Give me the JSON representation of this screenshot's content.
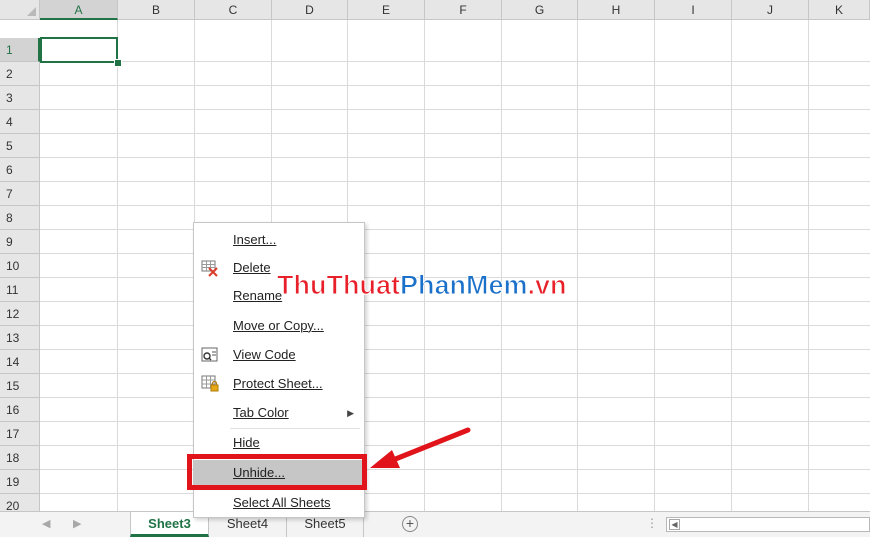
{
  "grid": {
    "columns": [
      "A",
      "B",
      "C",
      "D",
      "E",
      "F",
      "G",
      "H",
      "I",
      "J",
      "K"
    ],
    "rows": [
      "1",
      "2",
      "3",
      "4",
      "5",
      "6",
      "7",
      "8",
      "9",
      "10",
      "11",
      "12",
      "13",
      "14",
      "15",
      "16",
      "17",
      "18",
      "19",
      "20"
    ],
    "active_cell": "A1"
  },
  "context_menu": {
    "items": [
      {
        "label": "Insert...",
        "icon": ""
      },
      {
        "label": "Delete",
        "icon": "delete-sheet-icon"
      },
      {
        "label": "Rename",
        "icon": ""
      },
      {
        "label": "Move or Copy...",
        "icon": ""
      },
      {
        "label": "View Code",
        "icon": "view-code-icon"
      },
      {
        "label": "Protect Sheet...",
        "icon": "protect-sheet-icon"
      },
      {
        "label": "Tab Color",
        "icon": "",
        "submenu": "chevron-right-icon"
      },
      {
        "label": "Hide",
        "icon": ""
      },
      {
        "label": "Unhide...",
        "icon": "",
        "highlighted": true
      },
      {
        "label": "Select All Sheets",
        "icon": ""
      }
    ]
  },
  "tabs": [
    {
      "label": "Sheet3",
      "active": true
    },
    {
      "label": "Sheet4",
      "active": false
    },
    {
      "label": "Sheet5",
      "active": false
    }
  ],
  "watermark": {
    "part1": "ThuThuat",
    "part2": "PhanMem",
    "part3": ".vn"
  },
  "colors": {
    "accent": "#217346",
    "highlight_box": "#e0141a",
    "watermark_red": "#e8202a",
    "watermark_blue": "#1b71c9"
  }
}
